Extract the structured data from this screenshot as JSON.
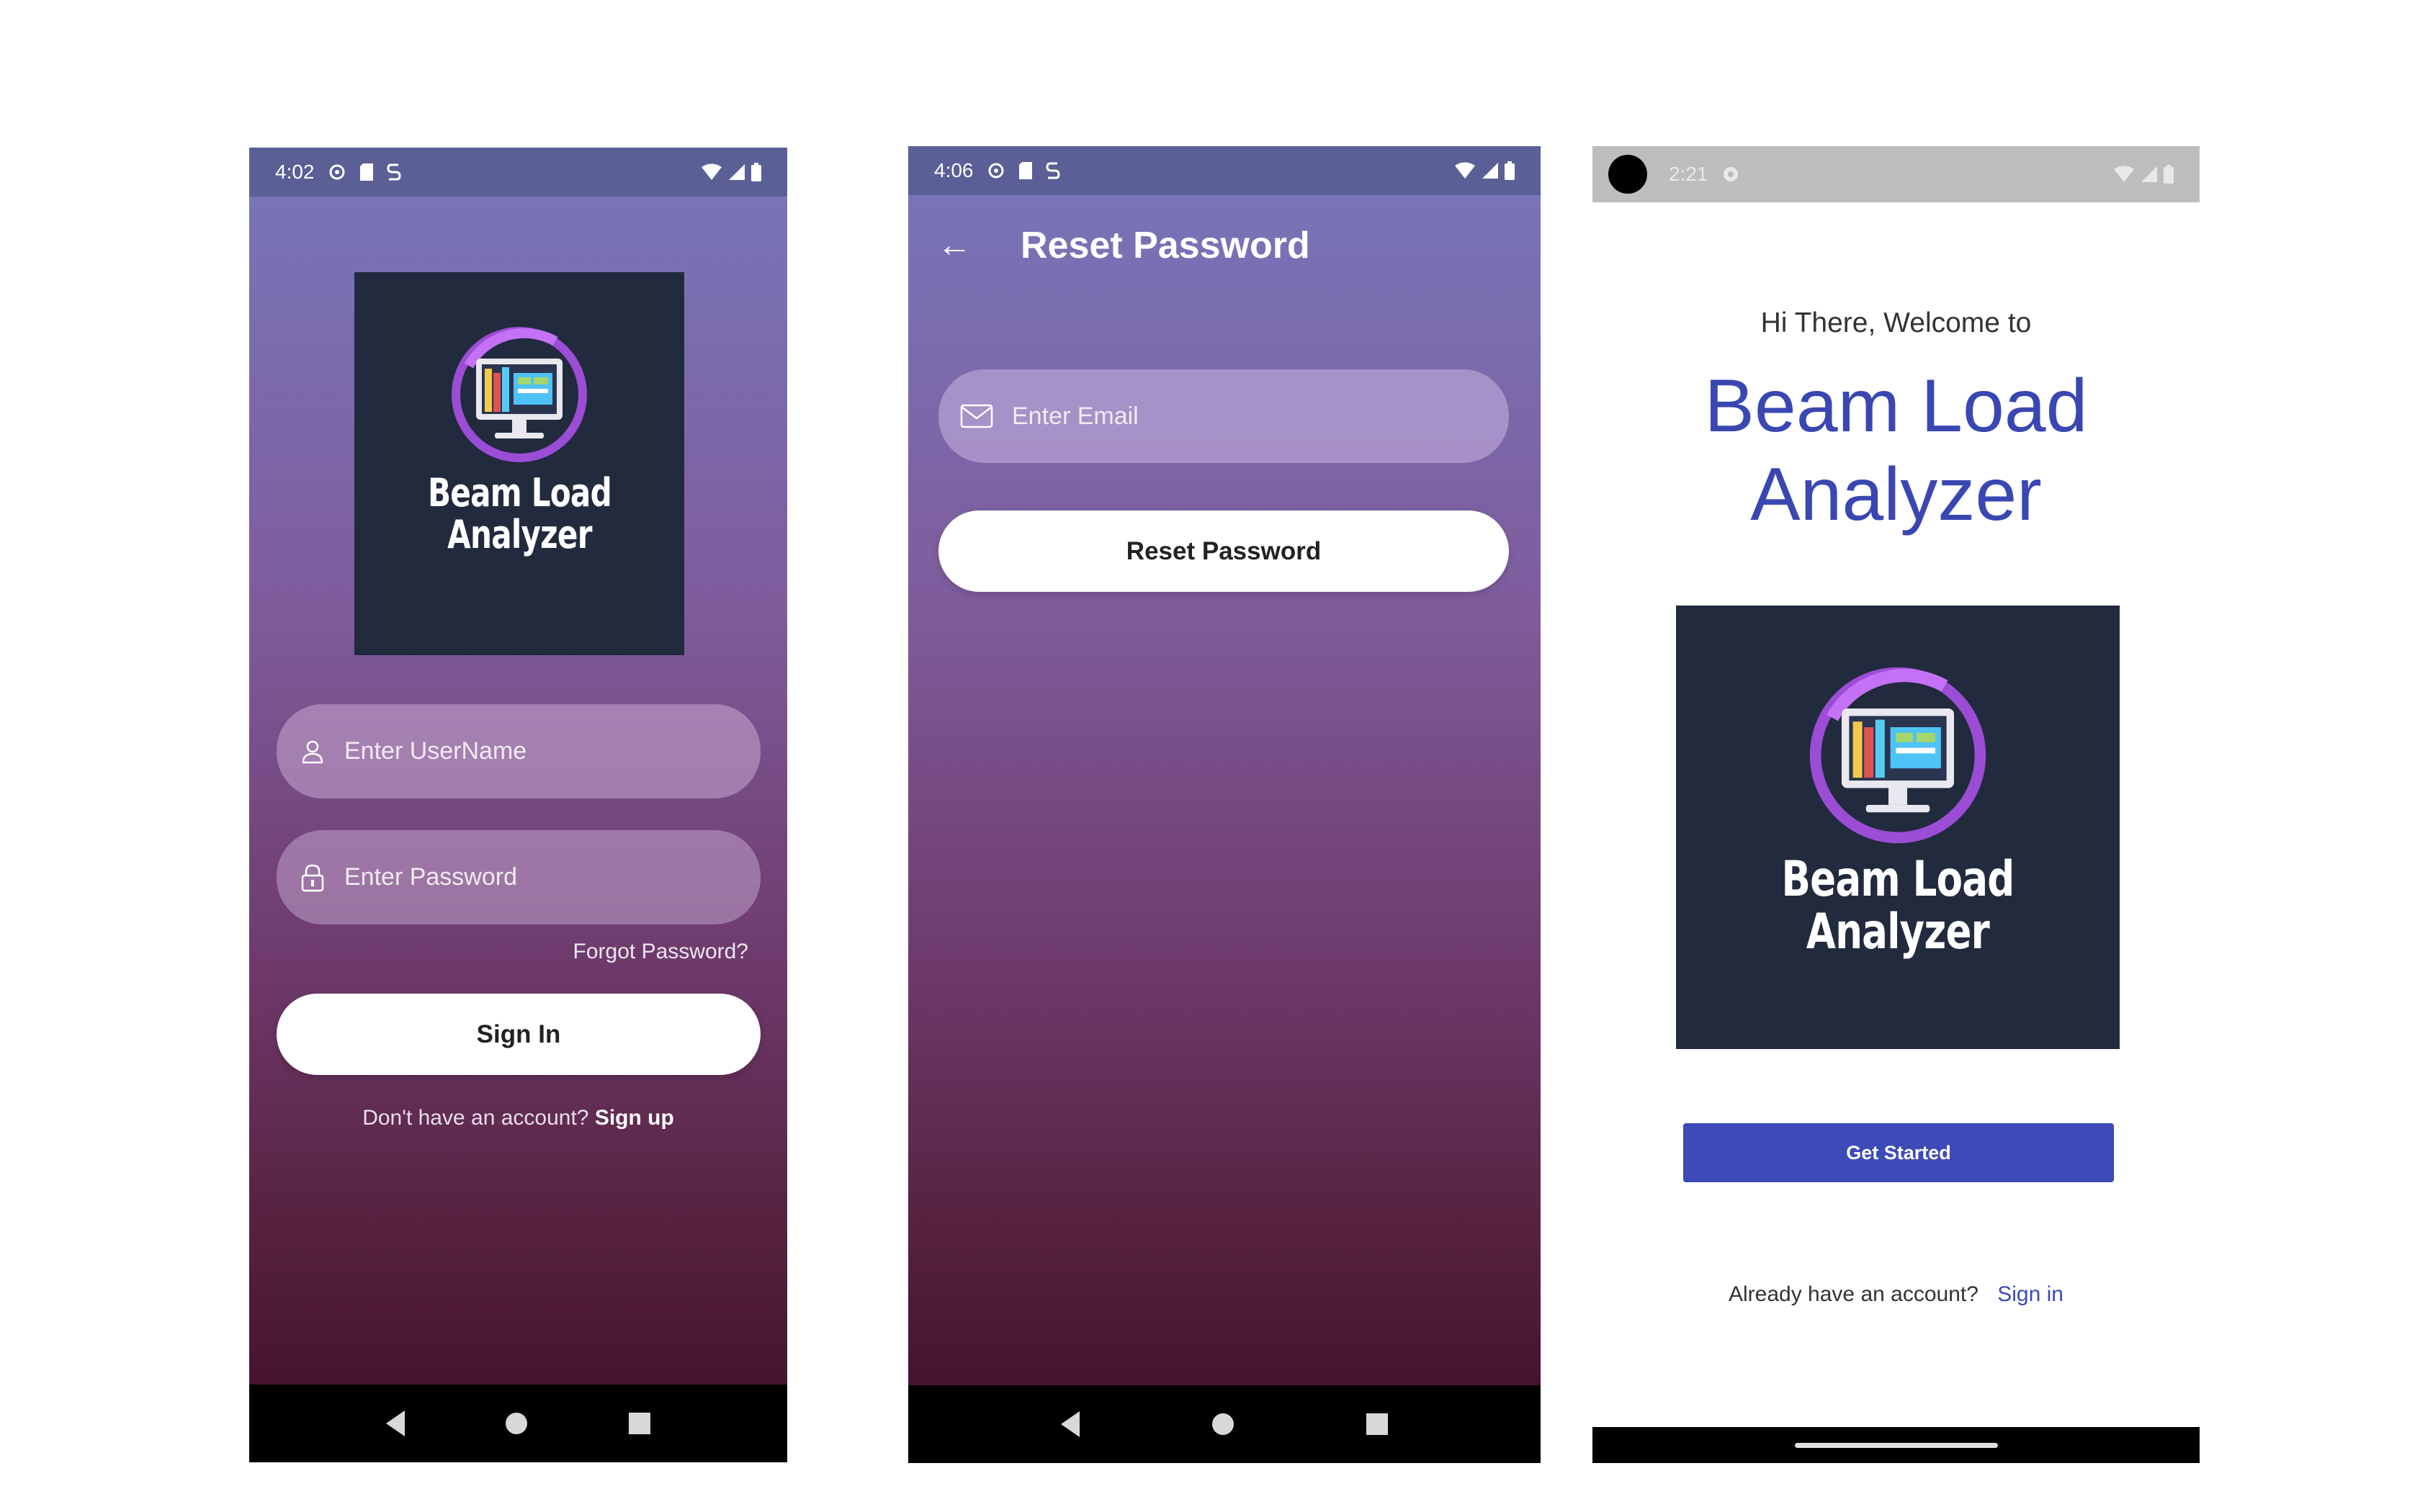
{
  "screen_login": {
    "status": {
      "time": "4:02"
    },
    "logo": {
      "line1": "Beam Load",
      "line2": "Analyzer"
    },
    "username": {
      "placeholder": "Enter UserName"
    },
    "password": {
      "placeholder": "Enter Password"
    },
    "forgot_password": "Forgot Password?",
    "sign_in": "Sign In",
    "no_account": "Don't have an account?",
    "sign_up": "Sign up"
  },
  "screen_reset": {
    "status": {
      "time": "4:06"
    },
    "title": "Reset Password",
    "email": {
      "placeholder": "Enter Email"
    },
    "reset_button": "Reset Password"
  },
  "screen_welcome": {
    "status": {
      "time": "2:21"
    },
    "greeting": "Hi There, Welcome to",
    "app_name": {
      "line1": "Beam Load",
      "line2": "Analyzer"
    },
    "logo": {
      "line1": "Beam Load",
      "line2": "Analyzer"
    },
    "get_started": "Get Started",
    "have_account": "Already have an account?",
    "sign_in": "Sign in"
  },
  "colors": {
    "gradient_top": "#7777bb",
    "gradient_bottom": "#3e0c28",
    "logo_bg": "#222a3e",
    "accent_blue": "#3d4ab7"
  }
}
